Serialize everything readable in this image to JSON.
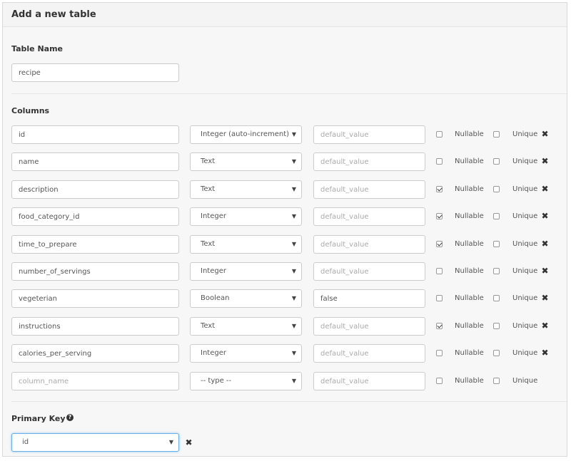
{
  "header": {
    "title": "Add a new table"
  },
  "table_name": {
    "label": "Table Name",
    "value": "recipe"
  },
  "columns": {
    "label": "Columns",
    "nullable_label": "Nullable",
    "unique_label": "Unique",
    "rows": [
      {
        "name": "id",
        "type": "Integer (auto-increment)",
        "default": "",
        "nullable": false,
        "unique": false,
        "removable": true
      },
      {
        "name": "name",
        "type": "Text",
        "default": "",
        "nullable": false,
        "unique": false,
        "removable": true
      },
      {
        "name": "description",
        "type": "Text",
        "default": "",
        "nullable": true,
        "unique": false,
        "removable": true
      },
      {
        "name": "food_category_id",
        "type": "Integer",
        "default": "",
        "nullable": true,
        "unique": false,
        "removable": true
      },
      {
        "name": "time_to_prepare",
        "type": "Text",
        "default": "",
        "nullable": true,
        "unique": false,
        "removable": true
      },
      {
        "name": "number_of_servings",
        "type": "Integer",
        "default": "",
        "nullable": false,
        "unique": false,
        "removable": true
      },
      {
        "name": "vegeterian",
        "type": "Boolean",
        "default": "false",
        "nullable": false,
        "unique": false,
        "removable": true
      },
      {
        "name": "instructions",
        "type": "Text",
        "default": "",
        "nullable": true,
        "unique": false,
        "removable": true
      },
      {
        "name": "calories_per_serving",
        "type": "Integer",
        "default": "",
        "nullable": false,
        "unique": false,
        "removable": true
      }
    ],
    "new_row": {
      "name_placeholder": "column_name",
      "type": "-- type --",
      "default_placeholder": "default_value"
    },
    "default_placeholder": "default_value"
  },
  "primary_key": {
    "label": "Primary Key",
    "help_icon": "question-circle-icon",
    "value": "id"
  },
  "icons": {
    "remove": "close-icon",
    "caret": "caret-down-icon"
  },
  "colors": {
    "focus_border": "#66afe9",
    "panel_bg": "#f7f7f7"
  }
}
